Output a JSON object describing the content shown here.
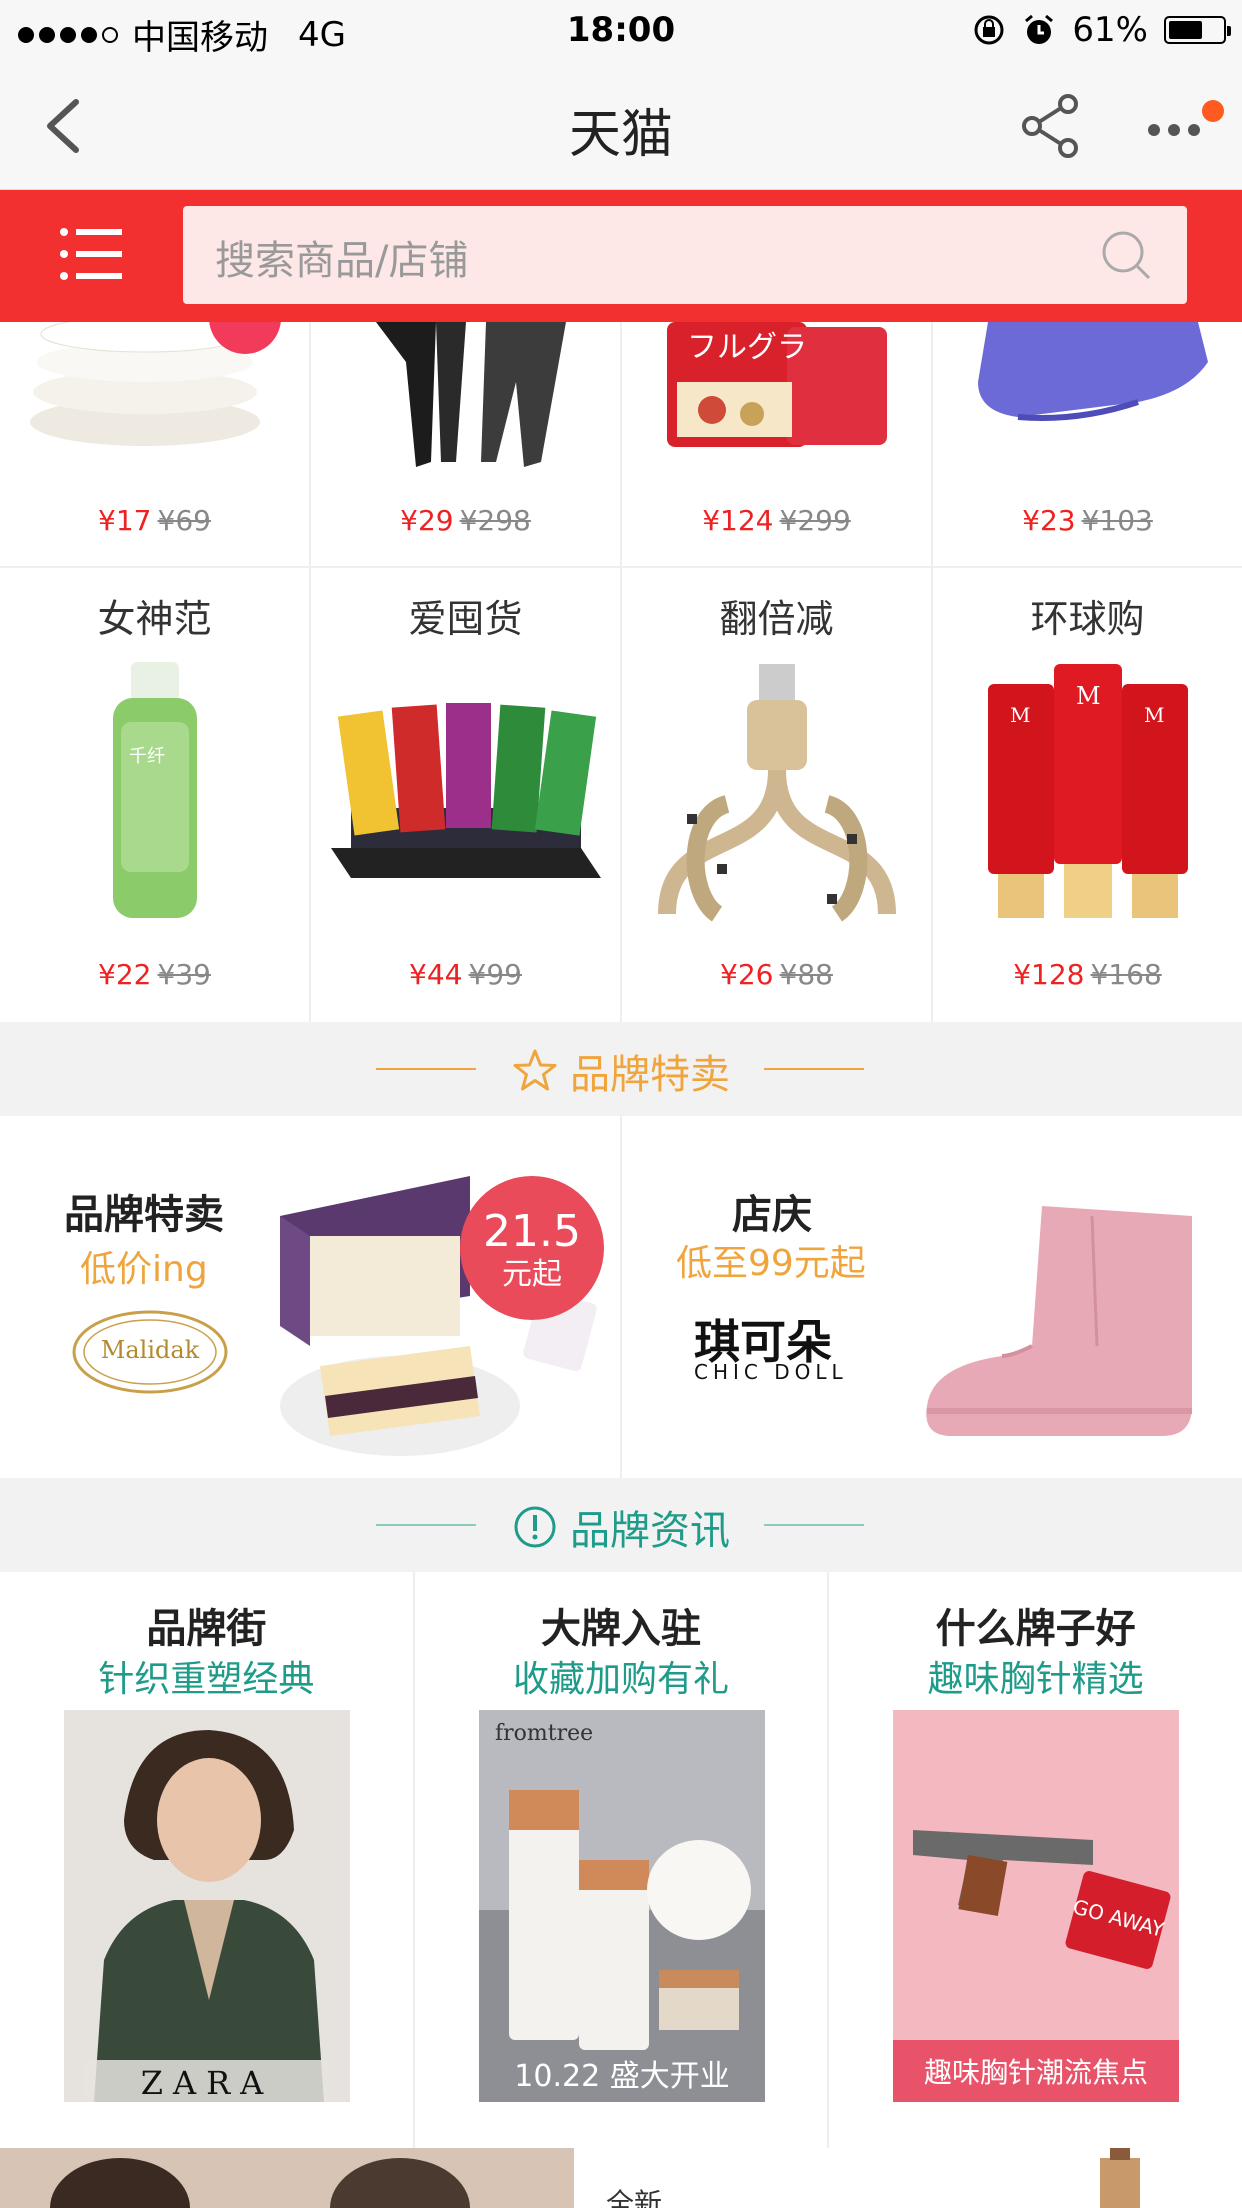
{
  "status_bar": {
    "carrier": "中国移动",
    "network": "4G",
    "time": "18:00",
    "battery": "61%",
    "battery_level": 0.61
  },
  "nav": {
    "title": "天猫",
    "back_icon": "chevron-left-icon",
    "share_icon": "share-icon",
    "more_icon": "more-icon"
  },
  "search": {
    "placeholder": "搜索商品/店铺",
    "menu_icon": "menu-icon",
    "search_icon": "search-icon"
  },
  "row1": [
    {
      "price": "¥17",
      "old_price": "¥69"
    },
    {
      "price": "¥29",
      "old_price": "¥298"
    },
    {
      "price": "¥124",
      "old_price": "¥299"
    },
    {
      "price": "¥23",
      "old_price": "¥103"
    }
  ],
  "row2": [
    {
      "title": "女神范",
      "price": "¥22",
      "old_price": "¥39"
    },
    {
      "title": "爱囤货",
      "price": "¥44",
      "old_price": "¥99"
    },
    {
      "title": "翻倍减",
      "price": "¥26",
      "old_price": "¥88"
    },
    {
      "title": "环球购",
      "price": "¥128",
      "old_price": "¥168"
    }
  ],
  "brand_sale_header": {
    "label": "品牌特卖",
    "icon": "star-icon",
    "color": "#f0a43c"
  },
  "brand_sale": {
    "left": {
      "title": "品牌特卖",
      "subtitle": "低价ing",
      "brand": "Malidak",
      "badge_big": "21.5",
      "badge_small": "元起"
    },
    "right": {
      "title": "店庆",
      "subtitle": "低至99元起",
      "brand": "琪可朵",
      "brand_en": "CHIC DOLL"
    }
  },
  "news_header": {
    "label": "品牌资讯",
    "icon": "exclamation-circle-icon",
    "color": "#1f9b8a"
  },
  "news": [
    {
      "title": "品牌街",
      "subtitle": "针织重塑经典",
      "img_text": "ZARA"
    },
    {
      "title": "大牌入驻",
      "subtitle": "收藏加购有礼",
      "img_text": "10.22 盛大开业",
      "img_brand": "fromtree"
    },
    {
      "title": "什么牌子好",
      "subtitle": "趣味胸针精选",
      "img_text": "趣味胸针潮流焦点",
      "img_badge": "GO AWAY"
    }
  ],
  "bottom_teaser": "全新",
  "colors": {
    "accent": "#f23030",
    "price": "#e22222"
  }
}
